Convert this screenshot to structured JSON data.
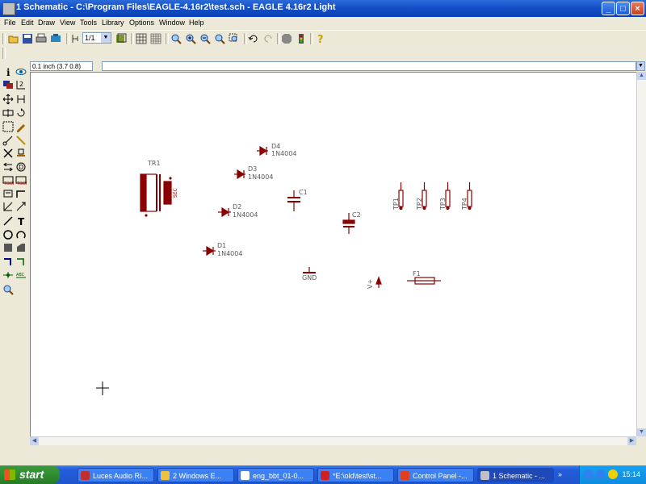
{
  "window": {
    "title": "1 Schematic - C:\\Program Files\\EAGLE-4.16r2\\test.sch - EAGLE 4.16r2 Light"
  },
  "menu": [
    "File",
    "Edit",
    "Draw",
    "View",
    "Tools",
    "Library",
    "Options",
    "Window",
    "Help"
  ],
  "toolbar": {
    "sheet_value": "1/1",
    "icons": [
      "open-icon",
      "save-icon",
      "print-icon",
      "cam-icon",
      "use-library-icon",
      "sheet-icon",
      "grid-icon",
      "layer-icon",
      "zoom-fit-icon",
      "zoom-in-icon",
      "zoom-out-icon",
      "redraw-icon",
      "zoom-select-icon",
      "undo-icon",
      "redo-icon",
      "stop-icon",
      "go-icon",
      "help-icon"
    ]
  },
  "command_line": {
    "coordinates": "0.1 inch (3.7 0.8)",
    "value": ""
  },
  "schematic": {
    "parts": {
      "tr1": {
        "name": "TR1",
        "pri": "PRI",
        "sec": "SEC"
      },
      "d1": {
        "name": "D1",
        "value": "1N4004"
      },
      "d2": {
        "name": "D2",
        "value": "1N4004"
      },
      "d3": {
        "name": "D3",
        "value": "1N4004"
      },
      "d4": {
        "name": "D4",
        "value": "1N4004"
      },
      "c1": {
        "name": "C1"
      },
      "c2": {
        "name": "C2"
      },
      "gnd": {
        "name": "GND"
      },
      "f1": {
        "name": "F1"
      },
      "vcc": {
        "name": "V+"
      },
      "tp1": {
        "name": "TP1"
      },
      "tp2": {
        "name": "TP2"
      },
      "tp3": {
        "name": "TP3"
      },
      "tp4": {
        "name": "TP4"
      }
    }
  },
  "taskbar": {
    "start_label": "start",
    "tasks": [
      {
        "label": "Luces Audio Rí..."
      },
      {
        "label": "2 Windows E..."
      },
      {
        "label": "eng_bbt_01-0..."
      },
      {
        "label": "*E:\\old\\test\\st..."
      },
      {
        "label": "Control Panel -..."
      },
      {
        "label": "1 Schematic - ..."
      }
    ],
    "clock": "15:14"
  },
  "colors": {
    "symbol": "#8b0000",
    "label_text": "#5a5a5a",
    "title_bar": "#1450c8"
  }
}
